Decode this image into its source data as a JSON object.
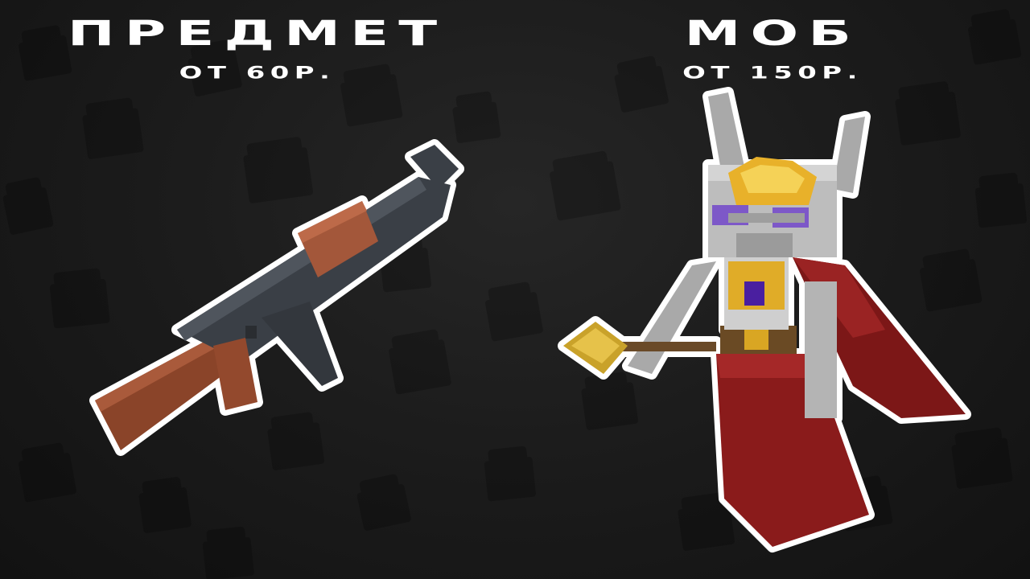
{
  "item_offer": {
    "title": "ПРЕДМЕТ",
    "price": "ОТ 60Р."
  },
  "mob_offer": {
    "title": "МОБ",
    "price": "ОТ 150Р."
  },
  "colors": {
    "background": "#171717",
    "text": "#ffffff",
    "gun_metal": "#3d4249",
    "gun_wood": "#9a4f33",
    "mob_cloak": "#8a1b1b",
    "mob_crown": "#e8b12a"
  },
  "icons": {
    "background_pattern": "treasure-chest-icon",
    "item_illustration": "rifle-icon",
    "mob_illustration": "skeleton-king-icon"
  }
}
